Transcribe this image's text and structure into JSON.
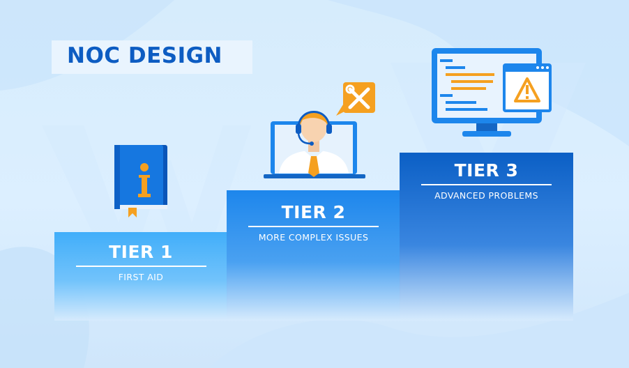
{
  "title": "NOC DESIGN",
  "tiers": [
    {
      "name": "TIER 1",
      "description": "FIRST AID",
      "icon": "info-book-icon"
    },
    {
      "name": "TIER 2",
      "description": "MORE COMPLEX ISSUES",
      "icon": "support-agent-icon"
    },
    {
      "name": "TIER 3",
      "description": "ADVANCED PROBLEMS",
      "icon": "monitor-warning-icon"
    }
  ],
  "colors": {
    "background": "#d6ecfc",
    "title": "#0d5cc2",
    "tier1": "#41aefa",
    "tier2": "#1d86ec",
    "tier3": "#0b5fc5",
    "accent_orange": "#f5a020",
    "text_white": "#ffffff"
  }
}
